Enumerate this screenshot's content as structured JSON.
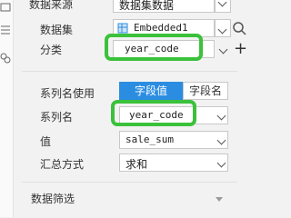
{
  "panel": {
    "rows": {
      "data_source": {
        "label": "数据来源",
        "value": "数据集数据"
      },
      "dataset": {
        "label": "数据集",
        "value": "Embedded1"
      },
      "category": {
        "label": "分类",
        "value": "year_code"
      },
      "series_name_use": {
        "label": "系列名使用",
        "option_active": "字段值",
        "option_inactive": "字段名"
      },
      "series_name": {
        "label": "系列名",
        "value": "year_code"
      },
      "value": {
        "label": "值",
        "value": "sale_sum"
      },
      "summary_method": {
        "label": "汇总方式",
        "value": "求和"
      }
    },
    "data_filter": {
      "label": "数据筛选"
    }
  },
  "icons": {
    "dataset_db": "database-icon",
    "search": "search-icon",
    "add": "plus-icon"
  },
  "colors": {
    "accent": "#2b8de1",
    "highlight": "#3bc13b"
  }
}
